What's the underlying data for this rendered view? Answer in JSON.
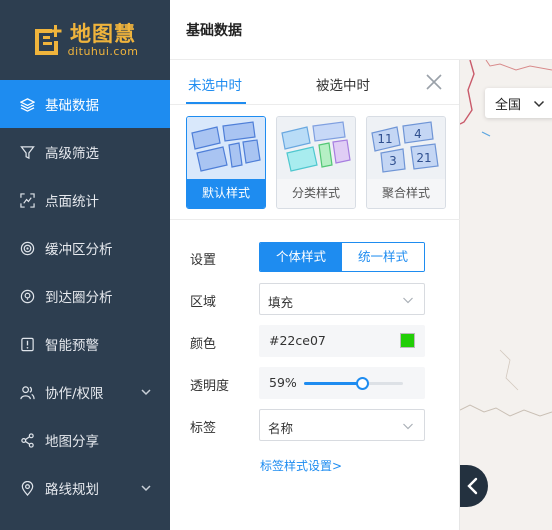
{
  "app": {
    "logo_cn": "地图慧",
    "logo_en": "dituhui.com",
    "brand_color": "#f0b43c"
  },
  "colors": {
    "sidebar_bg": "#2d3e50",
    "accent": "#1e8cf0",
    "fill_color": "#22ce07"
  },
  "sidebar": {
    "items": [
      {
        "label": "基础数据",
        "icon": "layers-icon",
        "active": true
      },
      {
        "label": "高级筛选",
        "icon": "filter-icon"
      },
      {
        "label": "点面统计",
        "icon": "point-stats-icon"
      },
      {
        "label": "缓冲区分析",
        "icon": "buffer-icon"
      },
      {
        "label": "到达圈分析",
        "icon": "reach-circle-icon"
      },
      {
        "label": "智能预警",
        "icon": "alert-icon"
      },
      {
        "label": "协作/权限",
        "icon": "users-icon",
        "expandable": true
      },
      {
        "label": "地图分享",
        "icon": "share-icon"
      },
      {
        "label": "路线规划",
        "icon": "route-icon",
        "expandable": true
      }
    ]
  },
  "header": {
    "title": "基础数据"
  },
  "panel": {
    "tabs": [
      {
        "label": "未选中时",
        "active": true
      },
      {
        "label": "被选中时"
      }
    ],
    "style_cards": [
      {
        "label": "默认样式",
        "selected": true
      },
      {
        "label": "分类样式"
      },
      {
        "label": "聚合样式",
        "numbers": [
          "11",
          "4",
          "3",
          "21"
        ]
      }
    ],
    "form": {
      "setting_label": "设置",
      "setting_options": [
        "个体样式",
        "统一样式"
      ],
      "setting_selected": "个体样式",
      "area_label": "区域",
      "area_value": "填充",
      "color_label": "颜色",
      "color_value": "#22ce07",
      "opacity_label": "透明度",
      "opacity_value": "59%",
      "opacity_fraction": 0.59,
      "tag_label": "标签",
      "tag_value": "名称",
      "tag_link": "标签样式设置>"
    }
  },
  "map": {
    "region_select": "全国"
  }
}
